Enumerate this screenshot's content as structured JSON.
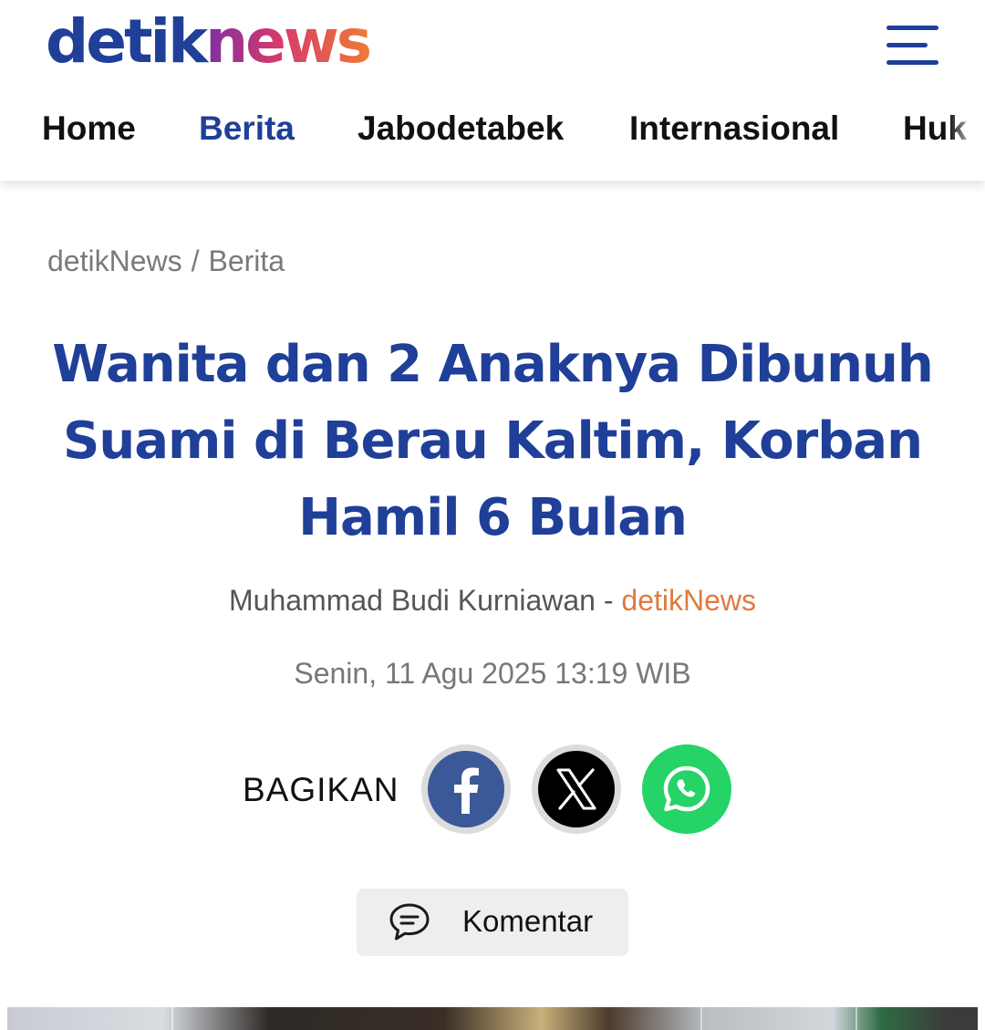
{
  "logo": {
    "part1": "detik",
    "part2": "news"
  },
  "nav": {
    "items": [
      {
        "label": "Home",
        "active": false
      },
      {
        "label": "Berita",
        "active": true
      },
      {
        "label": "Jabodetabek",
        "active": false
      },
      {
        "label": "Internasional",
        "active": false
      },
      {
        "label": "Huk",
        "active": false
      }
    ]
  },
  "breadcrumb": {
    "items": [
      "detikNews",
      "Berita"
    ],
    "separator": "/"
  },
  "article": {
    "title": "Wanita dan 2 Anaknya Dibunuh Suami di Berau Kaltim, Korban Hamil 6 Bulan",
    "author": "Muhammad Budi Kurniawan",
    "byline_separator": " - ",
    "source": "detikNews",
    "date": "Senin, 11 Agu 2025 13:19 WIB"
  },
  "share": {
    "label": "BAGIKAN",
    "buttons": [
      {
        "icon": "facebook-icon",
        "color": "#3b5998"
      },
      {
        "icon": "x-icon",
        "color": "#000000"
      },
      {
        "icon": "whatsapp-icon",
        "color": "#25d366"
      }
    ]
  },
  "comment": {
    "label": "Komentar",
    "icon": "comment-icon"
  },
  "colors": {
    "brand_blue": "#1f3f98",
    "source_orange": "#e07a3e"
  }
}
